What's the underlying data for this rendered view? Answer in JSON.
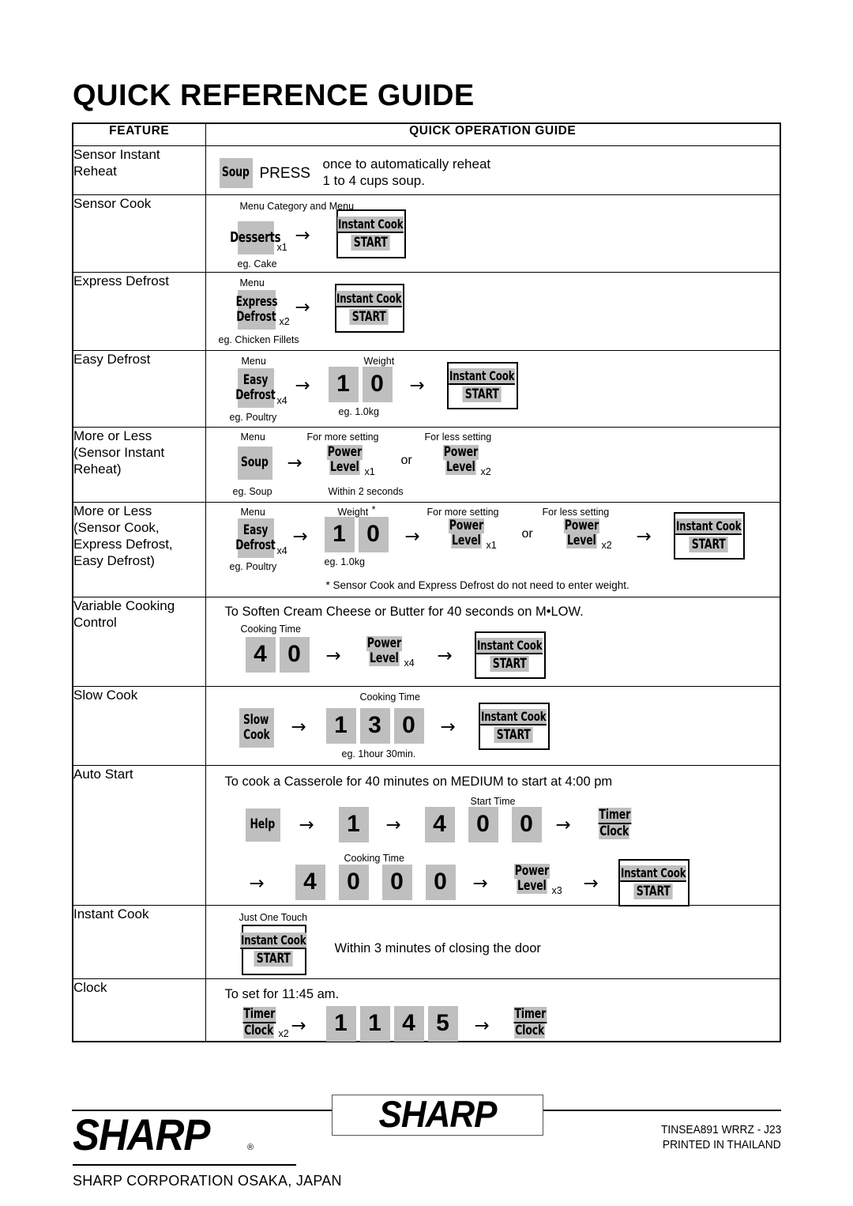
{
  "document": {
    "title": "QUICK REFERENCE GUIDE"
  },
  "table": {
    "headers": {
      "feature": "FEATURE",
      "guide": "QUICK OPERATION GUIDE"
    },
    "rows": [
      {
        "feature": "Sensor Instant\nReheat",
        "keys": {
          "soup": "Soup"
        },
        "press_word": "PRESS",
        "sentence": "once to automatically reheat\n1 to 4 cups soup."
      },
      {
        "feature": "Sensor Cook",
        "caption_top": "Menu Category and Menu",
        "keys": {
          "desserts": "Desserts"
        },
        "mult": "x1",
        "caption_bottom": "eg. Cake",
        "instant_cook": {
          "top": "Instant Cook",
          "bottom": "START"
        }
      },
      {
        "feature": "Express Defrost",
        "caption_top": "Menu",
        "keys": {
          "express": "Express",
          "defrost": "Defrost"
        },
        "mult": "x2",
        "caption_bottom": "eg. Chicken Fillets",
        "instant_cook": {
          "top": "Instant Cook",
          "bottom": "START"
        }
      },
      {
        "feature": "Easy Defrost",
        "caption_menu": "Menu",
        "caption_weight": "Weight",
        "keys": {
          "easy": "Easy",
          "defrost": "Defrost"
        },
        "mult": "x4",
        "caption_bottom": "eg. Poultry",
        "digits": [
          "1",
          "0"
        ],
        "caption_weight_eg": "eg. 1.0kg",
        "instant_cook": {
          "top": "Instant Cook",
          "bottom": "START"
        }
      },
      {
        "feature": "More or Less\n(Sensor Instant\nReheat)",
        "caption_menu": "Menu",
        "caption_more": "For more setting",
        "caption_less": "For less setting",
        "keys": {
          "soup": "Soup",
          "power": "Power",
          "level": "Level"
        },
        "mult_more": "x1",
        "mult_less": "x2",
        "or_word": "or",
        "caption_bottom": "eg. Soup",
        "caption_note": "Within 2 seconds"
      },
      {
        "feature": "More or Less\n(Sensor Cook,\nExpress Defrost,\nEasy Defrost)",
        "caption_menu": "Menu",
        "caption_weight": "Weight",
        "weight_star": "*",
        "caption_more": "For more setting",
        "caption_less": "For less setting",
        "keys": {
          "easy": "Easy",
          "defrost": "Defrost",
          "power": "Power",
          "level": "Level"
        },
        "mult": "x4",
        "mult_more": "x1",
        "mult_less": "x2",
        "or_word": "or",
        "digits": [
          "1",
          "0"
        ],
        "caption_bottom": "eg. Poultry",
        "caption_weight_eg": "eg. 1.0kg",
        "footnote": "* Sensor Cook and Express Defrost do not need to enter weight.",
        "instant_cook": {
          "top": "Instant Cook",
          "bottom": "START"
        }
      },
      {
        "feature": "Variable Cooking\nControl",
        "sentence": "To Soften Cream Cheese or Butter  for 40 seconds on M•LOW.",
        "caption_cooking_time": "Cooking Time",
        "digits": [
          "4",
          "0"
        ],
        "keys": {
          "power": "Power",
          "level": "Level"
        },
        "mult": "x4",
        "instant_cook": {
          "top": "Instant Cook",
          "bottom": "START"
        }
      },
      {
        "feature": "Slow Cook",
        "caption_cooking_time": "Cooking Time",
        "keys": {
          "slow": "Slow",
          "cook": "Cook"
        },
        "digits": [
          "1",
          "3",
          "0"
        ],
        "caption_bottom": "eg. 1hour 30min.",
        "instant_cook": {
          "top": "Instant Cook",
          "bottom": "START"
        }
      },
      {
        "feature": "Auto Start",
        "sentence": "To cook a Casserole for 40 minutes on MEDIUM to start at 4:00 pm",
        "caption_start_time": "Start Time",
        "caption_cooking_time": "Cooking Time",
        "keys": {
          "help": "Help",
          "timer": "Timer",
          "clock": "Clock",
          "power": "Power",
          "level": "Level"
        },
        "digits_row1_a": [
          "1"
        ],
        "digits_row1_b": [
          "4",
          "0",
          "0"
        ],
        "digits_row2": [
          "4",
          "0",
          "0",
          "0"
        ],
        "mult": "x3",
        "instant_cook": {
          "top": "Instant Cook",
          "bottom": "START"
        }
      },
      {
        "feature": "Instant Cook",
        "caption_top": "Just One Touch",
        "instant_cook": {
          "top": "Instant Cook",
          "bottom": "START"
        },
        "sentence": "Within 3 minutes of closing the door"
      },
      {
        "feature": "Clock",
        "sentence": "To set for 11:45 am.",
        "keys": {
          "timer": "Timer",
          "clock": "Clock"
        },
        "mult": "x2",
        "digits": [
          "1",
          "1",
          "4",
          "5"
        ]
      }
    ]
  },
  "footer": {
    "brand": "SHARP",
    "brand_registered": "®",
    "corporation": "SHARP CORPORATION OSAKA, JAPAN",
    "code": "TINSEA891 WRRZ - J23",
    "printed": "PRINTED IN THAILAND"
  }
}
